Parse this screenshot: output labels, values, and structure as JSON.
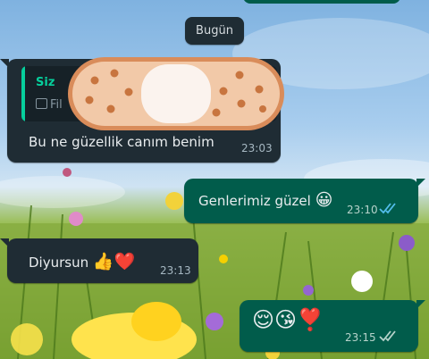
{
  "date_chip": "Bugün",
  "messages": [
    {
      "reply": {
        "sender": "Siz",
        "separator": "·",
        "preview_prefix": "Fil"
      },
      "text": "Bu ne güzellik canım benim",
      "time": "23:03"
    },
    {
      "text": "Genlerimiz güzel",
      "emoji": "😀",
      "time": "23:10",
      "status": "read"
    },
    {
      "text": "Diyursun",
      "emoji": "👍❤️",
      "time": "23:13"
    },
    {
      "emoji": "😌😘❣️",
      "time": "23:15",
      "status": "delivered"
    }
  ],
  "colors": {
    "incoming_bubble": "#1f2c34",
    "outgoing_bubble": "#015c4b",
    "read_ticks": "#53bdeb",
    "delivered_ticks": "#b7d3cb",
    "reply_accent": "#06cf9c"
  },
  "overlay_sticker": "bandage-sticker"
}
